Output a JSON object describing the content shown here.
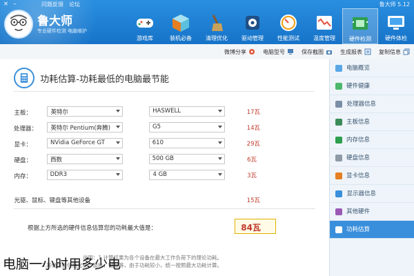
{
  "app": {
    "title": "鲁大师",
    "version": "鲁大师 5.12",
    "slogan": "专业硬件检测 电脑维护",
    "top_links": [
      "论坛",
      "问题反馈"
    ],
    "window_controls": [
      "minimize",
      "close"
    ]
  },
  "nav": [
    {
      "label": "硬件体检",
      "icon": "monitor-icon"
    },
    {
      "label": "硬件检测",
      "icon": "chip-icon",
      "active": true
    },
    {
      "label": "温度管理",
      "icon": "thermometer-icon"
    },
    {
      "label": "性能测试",
      "icon": "gauge-icon"
    },
    {
      "label": "驱动管理",
      "icon": "gear-icon"
    },
    {
      "label": "清理优化",
      "icon": "broom-icon"
    },
    {
      "label": "装机必备",
      "icon": "box-icon"
    },
    {
      "label": "游戏库",
      "icon": "gamepad-icon"
    }
  ],
  "toolbar": {
    "copy": "复制信息",
    "save": "生成报表",
    "screenshot": "保存截图",
    "pc_model": "电脑型号",
    "share": "微博分享"
  },
  "sidebar": [
    {
      "label": "电脑概览"
    },
    {
      "label": "硬件健康"
    },
    {
      "label": "处理器信息"
    },
    {
      "label": "主板信息"
    },
    {
      "label": "内存信息"
    },
    {
      "label": "硬盘信息"
    },
    {
      "label": "显卡信息"
    },
    {
      "label": "显示器信息"
    },
    {
      "label": "其他硬件"
    },
    {
      "label": "功耗估算",
      "active": true
    }
  ],
  "main": {
    "heading": "功耗估算-功耗最低的电脑最节能",
    "rows": [
      {
        "label": "主板：",
        "brand": "英特尔",
        "model": "HASWELL",
        "watts": "17瓦"
      },
      {
        "label": "处理器：",
        "brand": "英特尔 Pentium(奔腾)",
        "model": "G5",
        "watts": "14瓦"
      },
      {
        "label": "显卡：",
        "brand": "NVidia GeForce GT",
        "model": "610",
        "watts": "29瓦"
      },
      {
        "label": "硬盘：",
        "brand": "西数",
        "model": "500 GB",
        "watts": "6瓦"
      },
      {
        "label": "内存：",
        "brand": "DDR3",
        "model": "4 GB",
        "watts": "3瓦"
      }
    ],
    "other_label": "光驱、鼠标、键盘等其他设备",
    "other_watts": "15瓦",
    "total_desc": "根据上方所选的硬件信息估算您的功耗最大值是：",
    "total_value": "84瓦",
    "note_lines": [
      "说明：1.计算结果为各个设备在最大工作负荷下的理论功耗。",
      "2.其他设备包括光驱，鼠标，键盘等，由于功耗较小，统一按照最大功耗计算。"
    ]
  },
  "caption": "电脑一小时用多少电"
}
